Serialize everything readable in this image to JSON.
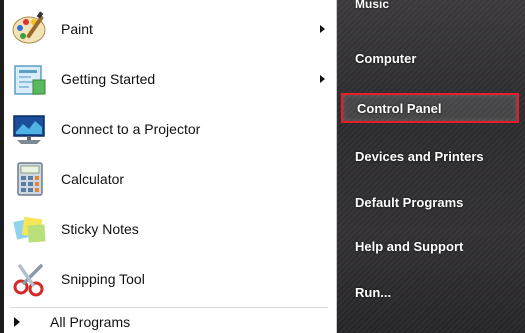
{
  "programs": [
    {
      "label": "Paint",
      "icon": "paint-icon",
      "has_submenu": true
    },
    {
      "label": "Getting Started",
      "icon": "getting-started-icon",
      "has_submenu": true
    },
    {
      "label": "Connect to a Projector",
      "icon": "projector-icon",
      "has_submenu": false
    },
    {
      "label": "Calculator",
      "icon": "calculator-icon",
      "has_submenu": false
    },
    {
      "label": "Sticky Notes",
      "icon": "sticky-notes-icon",
      "has_submenu": false
    },
    {
      "label": "Snipping Tool",
      "icon": "snipping-tool-icon",
      "has_submenu": false
    }
  ],
  "all_programs": {
    "label": "All Programs"
  },
  "places": [
    {
      "label": "Music"
    },
    {
      "label": "Computer"
    },
    {
      "label": "Control Panel",
      "highlighted": true
    },
    {
      "label": "Devices and Printers"
    },
    {
      "label": "Default Programs"
    },
    {
      "label": "Help and Support"
    },
    {
      "label": "Run..."
    }
  ],
  "colors": {
    "highlight_border": "#e81c2a",
    "right_pane_bg": "#333134"
  }
}
